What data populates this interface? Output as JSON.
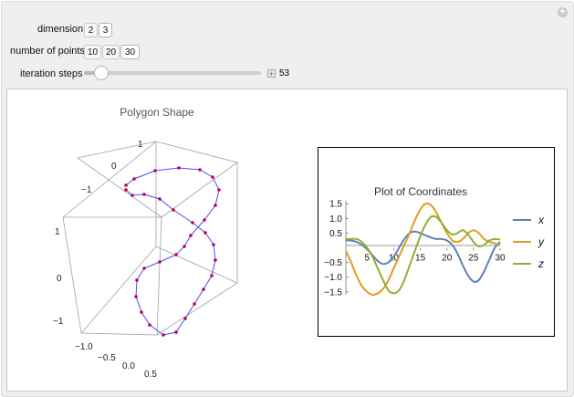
{
  "controls": {
    "dimension": {
      "label": "dimension",
      "options": [
        "2",
        "3"
      ],
      "selected": "3"
    },
    "points": {
      "label": "number of points",
      "options": [
        "10",
        "20",
        "30"
      ],
      "selected": "30"
    },
    "iterations": {
      "label": "iteration steps",
      "value": "53",
      "fraction": 0.1
    }
  },
  "polygon_plot": {
    "title": "Polygon Shape",
    "x_ticks": [
      "−1.0",
      "−0.5",
      "0.0",
      "0.5"
    ],
    "y_ticks": [
      "1",
      "0",
      "−1"
    ],
    "z_ticks": [
      "1",
      "0",
      "−1"
    ],
    "colors": {
      "line": "#4b4bff",
      "points": "#c0004d",
      "box": "#9a9a9a"
    }
  },
  "chart_data": {
    "type": "line",
    "title": "Plot of Coordinates",
    "xlabel": "",
    "ylabel": "",
    "x_ticks": [
      5,
      10,
      15,
      20,
      25,
      30
    ],
    "y_ticks": [
      1.5,
      1.0,
      0.5,
      -0.5,
      -1.0,
      -1.5
    ],
    "y_tick_labels": [
      "1.5",
      "1.0",
      "0.5",
      "−0.5",
      "−1.0",
      "−1.5"
    ],
    "x_tick_labels": [
      "5",
      "10",
      "15",
      "20",
      "25",
      "30"
    ],
    "xlim": [
      1,
      30
    ],
    "ylim": [
      -1.6,
      1.6
    ],
    "legend_position": "right",
    "series": [
      {
        "name": "x",
        "color": "#5e81b5",
        "x": [
          1,
          2,
          3,
          4,
          5,
          6,
          7,
          8,
          9,
          10,
          11,
          12,
          13,
          14,
          15,
          16,
          17,
          18,
          19,
          20,
          21,
          22,
          23,
          24,
          25,
          26,
          27,
          28,
          29,
          30
        ],
        "values": [
          0.25,
          0.25,
          0.2,
          0.1,
          -0.05,
          -0.25,
          -0.45,
          -0.55,
          -0.5,
          -0.3,
          0,
          0.3,
          0.5,
          0.55,
          0.5,
          0.42,
          0.35,
          0.3,
          0.3,
          0.25,
          0.1,
          -0.2,
          -0.6,
          -0.95,
          -1.15,
          -1.1,
          -0.8,
          -0.4,
          0,
          0.2
        ]
      },
      {
        "name": "y",
        "color": "#e19c24",
        "x": [
          1,
          2,
          3,
          4,
          5,
          6,
          7,
          8,
          9,
          10,
          11,
          12,
          13,
          14,
          15,
          16,
          17,
          18,
          19,
          20,
          21,
          22,
          23,
          24,
          25,
          26,
          27,
          28,
          29,
          30
        ],
        "values": [
          -0.1,
          -0.5,
          -0.95,
          -1.3,
          -1.5,
          -1.6,
          -1.55,
          -1.4,
          -1.1,
          -0.7,
          -0.3,
          0.1,
          0.5,
          0.95,
          1.3,
          1.5,
          1.45,
          1.2,
          0.85,
          0.5,
          0.25,
          0.2,
          0.3,
          0.5,
          0.6,
          0.5,
          0.3,
          0.2,
          0.15,
          0.1
        ]
      },
      {
        "name": "z",
        "color": "#8fb032",
        "x": [
          1,
          2,
          3,
          4,
          5,
          6,
          7,
          8,
          9,
          10,
          11,
          12,
          13,
          14,
          15,
          16,
          17,
          18,
          19,
          20,
          21,
          22,
          23,
          24,
          25,
          26,
          27,
          28,
          29,
          30
        ],
        "values": [
          0.3,
          0.3,
          0.3,
          0.2,
          0,
          -0.3,
          -0.7,
          -1.1,
          -1.45,
          -1.55,
          -1.45,
          -1.1,
          -0.6,
          -0.1,
          0.4,
          0.8,
          1.05,
          1.05,
          0.85,
          0.6,
          0.45,
          0.5,
          0.6,
          0.45,
          0.2,
          0.05,
          0.1,
          0.25,
          0.3,
          0.28
        ]
      }
    ]
  }
}
